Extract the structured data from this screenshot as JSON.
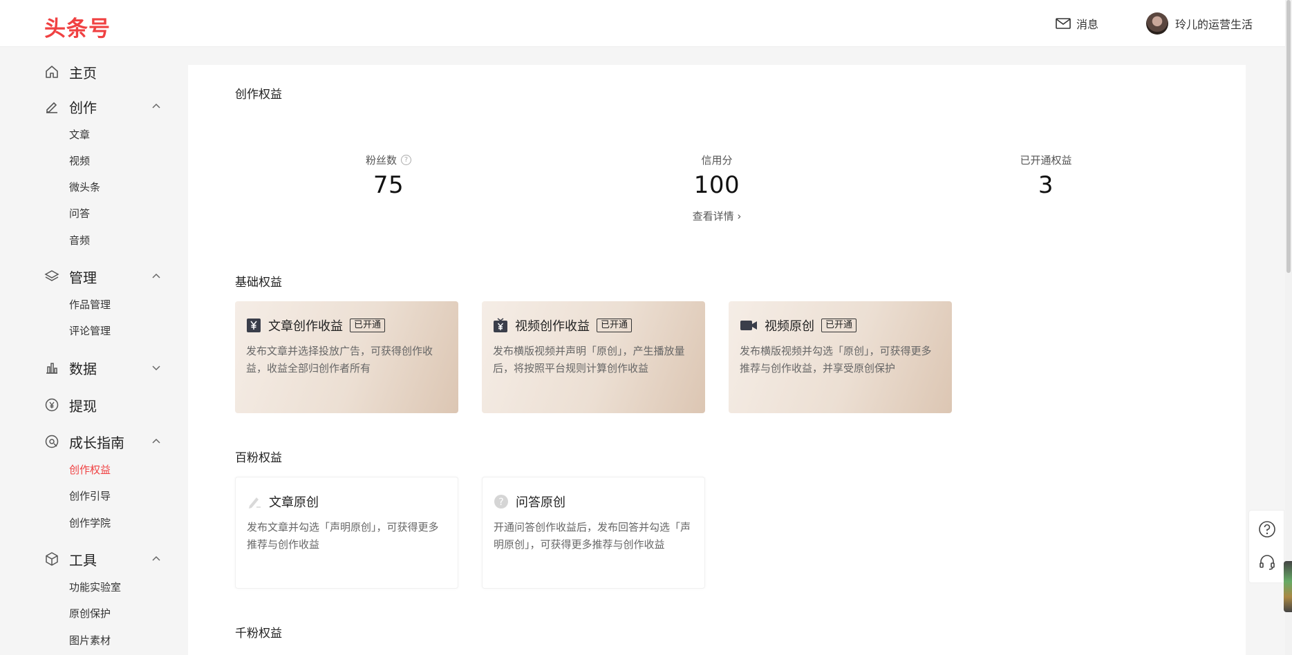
{
  "header": {
    "logo": "头条号",
    "messages_label": "消息",
    "username": "玲儿的运营生活"
  },
  "sidebar": {
    "home": "主页",
    "create": {
      "label": "创作",
      "items": [
        "文章",
        "视频",
        "微头条",
        "问答",
        "音频"
      ]
    },
    "manage": {
      "label": "管理",
      "items": [
        "作品管理",
        "评论管理"
      ]
    },
    "data": {
      "label": "数据"
    },
    "withdraw": {
      "label": "提现"
    },
    "growth": {
      "label": "成长指南",
      "items": [
        "创作权益",
        "创作引导",
        "创作学院"
      ],
      "active": "创作权益"
    },
    "tools": {
      "label": "工具",
      "items": [
        "功能实验室",
        "原创保护",
        "图片素材"
      ]
    }
  },
  "main": {
    "title": "创作权益",
    "stats": {
      "fans_label": "粉丝数",
      "fans_value": "75",
      "credit_label": "信用分",
      "credit_value": "100",
      "credit_link": "查看详情",
      "rights_label": "已开通权益",
      "rights_value": "3"
    },
    "basic": {
      "title": "基础权益",
      "cards": [
        {
          "title": "文章创作收益",
          "badge": "已开通",
          "desc": "发布文章并选择投放广告，可获得创作收益，收益全部归创作者所有",
          "icon": "yen-icon"
        },
        {
          "title": "视频创作收益",
          "badge": "已开通",
          "desc": "发布横版视频并声明「原创」，产生播放量后，将按照平台规则计算创作收益",
          "icon": "tv-yen-icon"
        },
        {
          "title": "视频原创",
          "badge": "已开通",
          "desc": "发布横版视频并勾选「原创」，可获得更多推荐与创作收益，并享受原创保护",
          "icon": "video-camera-icon"
        }
      ]
    },
    "hundred": {
      "title": "百粉权益",
      "cards": [
        {
          "title": "文章原创",
          "desc": "发布文章并勾选「声明原创」，可获得更多推荐与创作收益",
          "icon": "pen-icon"
        },
        {
          "title": "问答原创",
          "desc": "开通问答创作收益后，发布回答并勾选「声明原创」，可获得更多推荐与创作收益",
          "icon": "question-icon"
        }
      ]
    },
    "thousand": {
      "title": "千粉权益"
    }
  },
  "colors": {
    "brand": "#f04142",
    "card_gold_start": "#f5ede6",
    "card_gold_end": "#dcc6b3"
  }
}
